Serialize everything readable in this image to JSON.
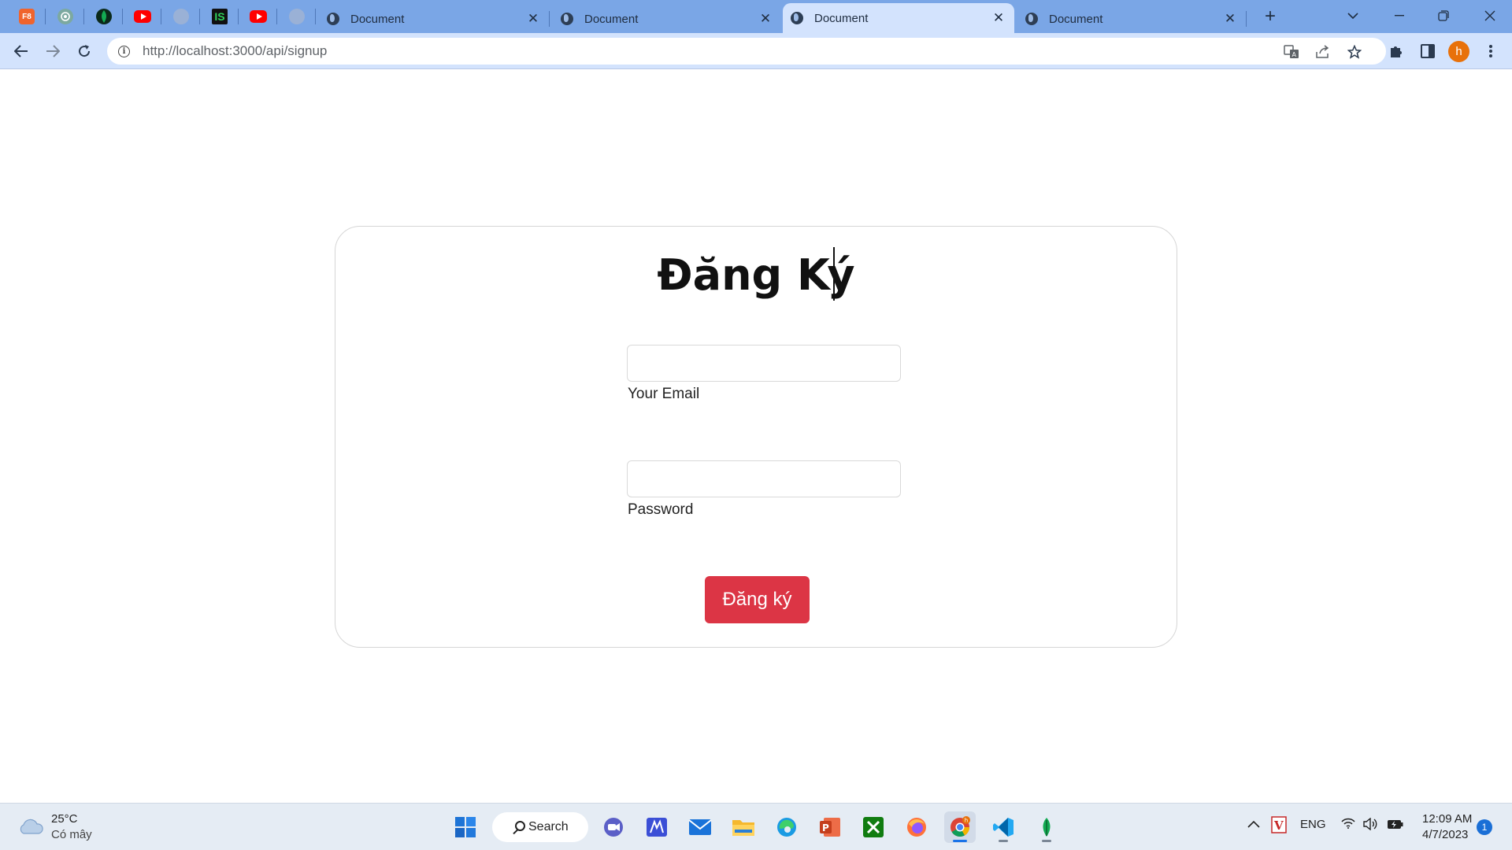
{
  "browser": {
    "pinned_tabs": [
      {
        "label": "F8"
      },
      {
        "label": ""
      },
      {
        "label": ""
      },
      {
        "label": ""
      },
      {
        "label": ""
      },
      {
        "label": "IS"
      },
      {
        "label": ""
      },
      {
        "label": ""
      }
    ],
    "tabs": [
      {
        "title": "Document"
      },
      {
        "title": "Document"
      },
      {
        "title": "Document"
      },
      {
        "title": "Document"
      }
    ],
    "new_tab": "+",
    "url": "http://localhost:3000/api/signup",
    "profile_initial": "h",
    "icons": {
      "back": "arrow-left",
      "forward": "arrow-right",
      "reload": "reload",
      "translate": "translate",
      "share": "share",
      "star": "star",
      "extensions": "puzzle",
      "sidepanel": "side-panel",
      "menu": "kebab-menu"
    }
  },
  "page": {
    "heading": "Đăng Ký",
    "email_label": "Your Email",
    "email_value": "",
    "password_label": "Password",
    "password_value": "",
    "submit_label": "Đăng ký",
    "colors": {
      "submit": "#dc3545",
      "border": "#d6d6d6"
    }
  },
  "taskbar": {
    "weather_temp": "25°C",
    "weather_desc": "Có mây",
    "search_label": "Search",
    "language": "ENG",
    "time": "12:09 AM",
    "date": "4/7/2023",
    "notification_count": "1",
    "profile_badge": "h"
  }
}
